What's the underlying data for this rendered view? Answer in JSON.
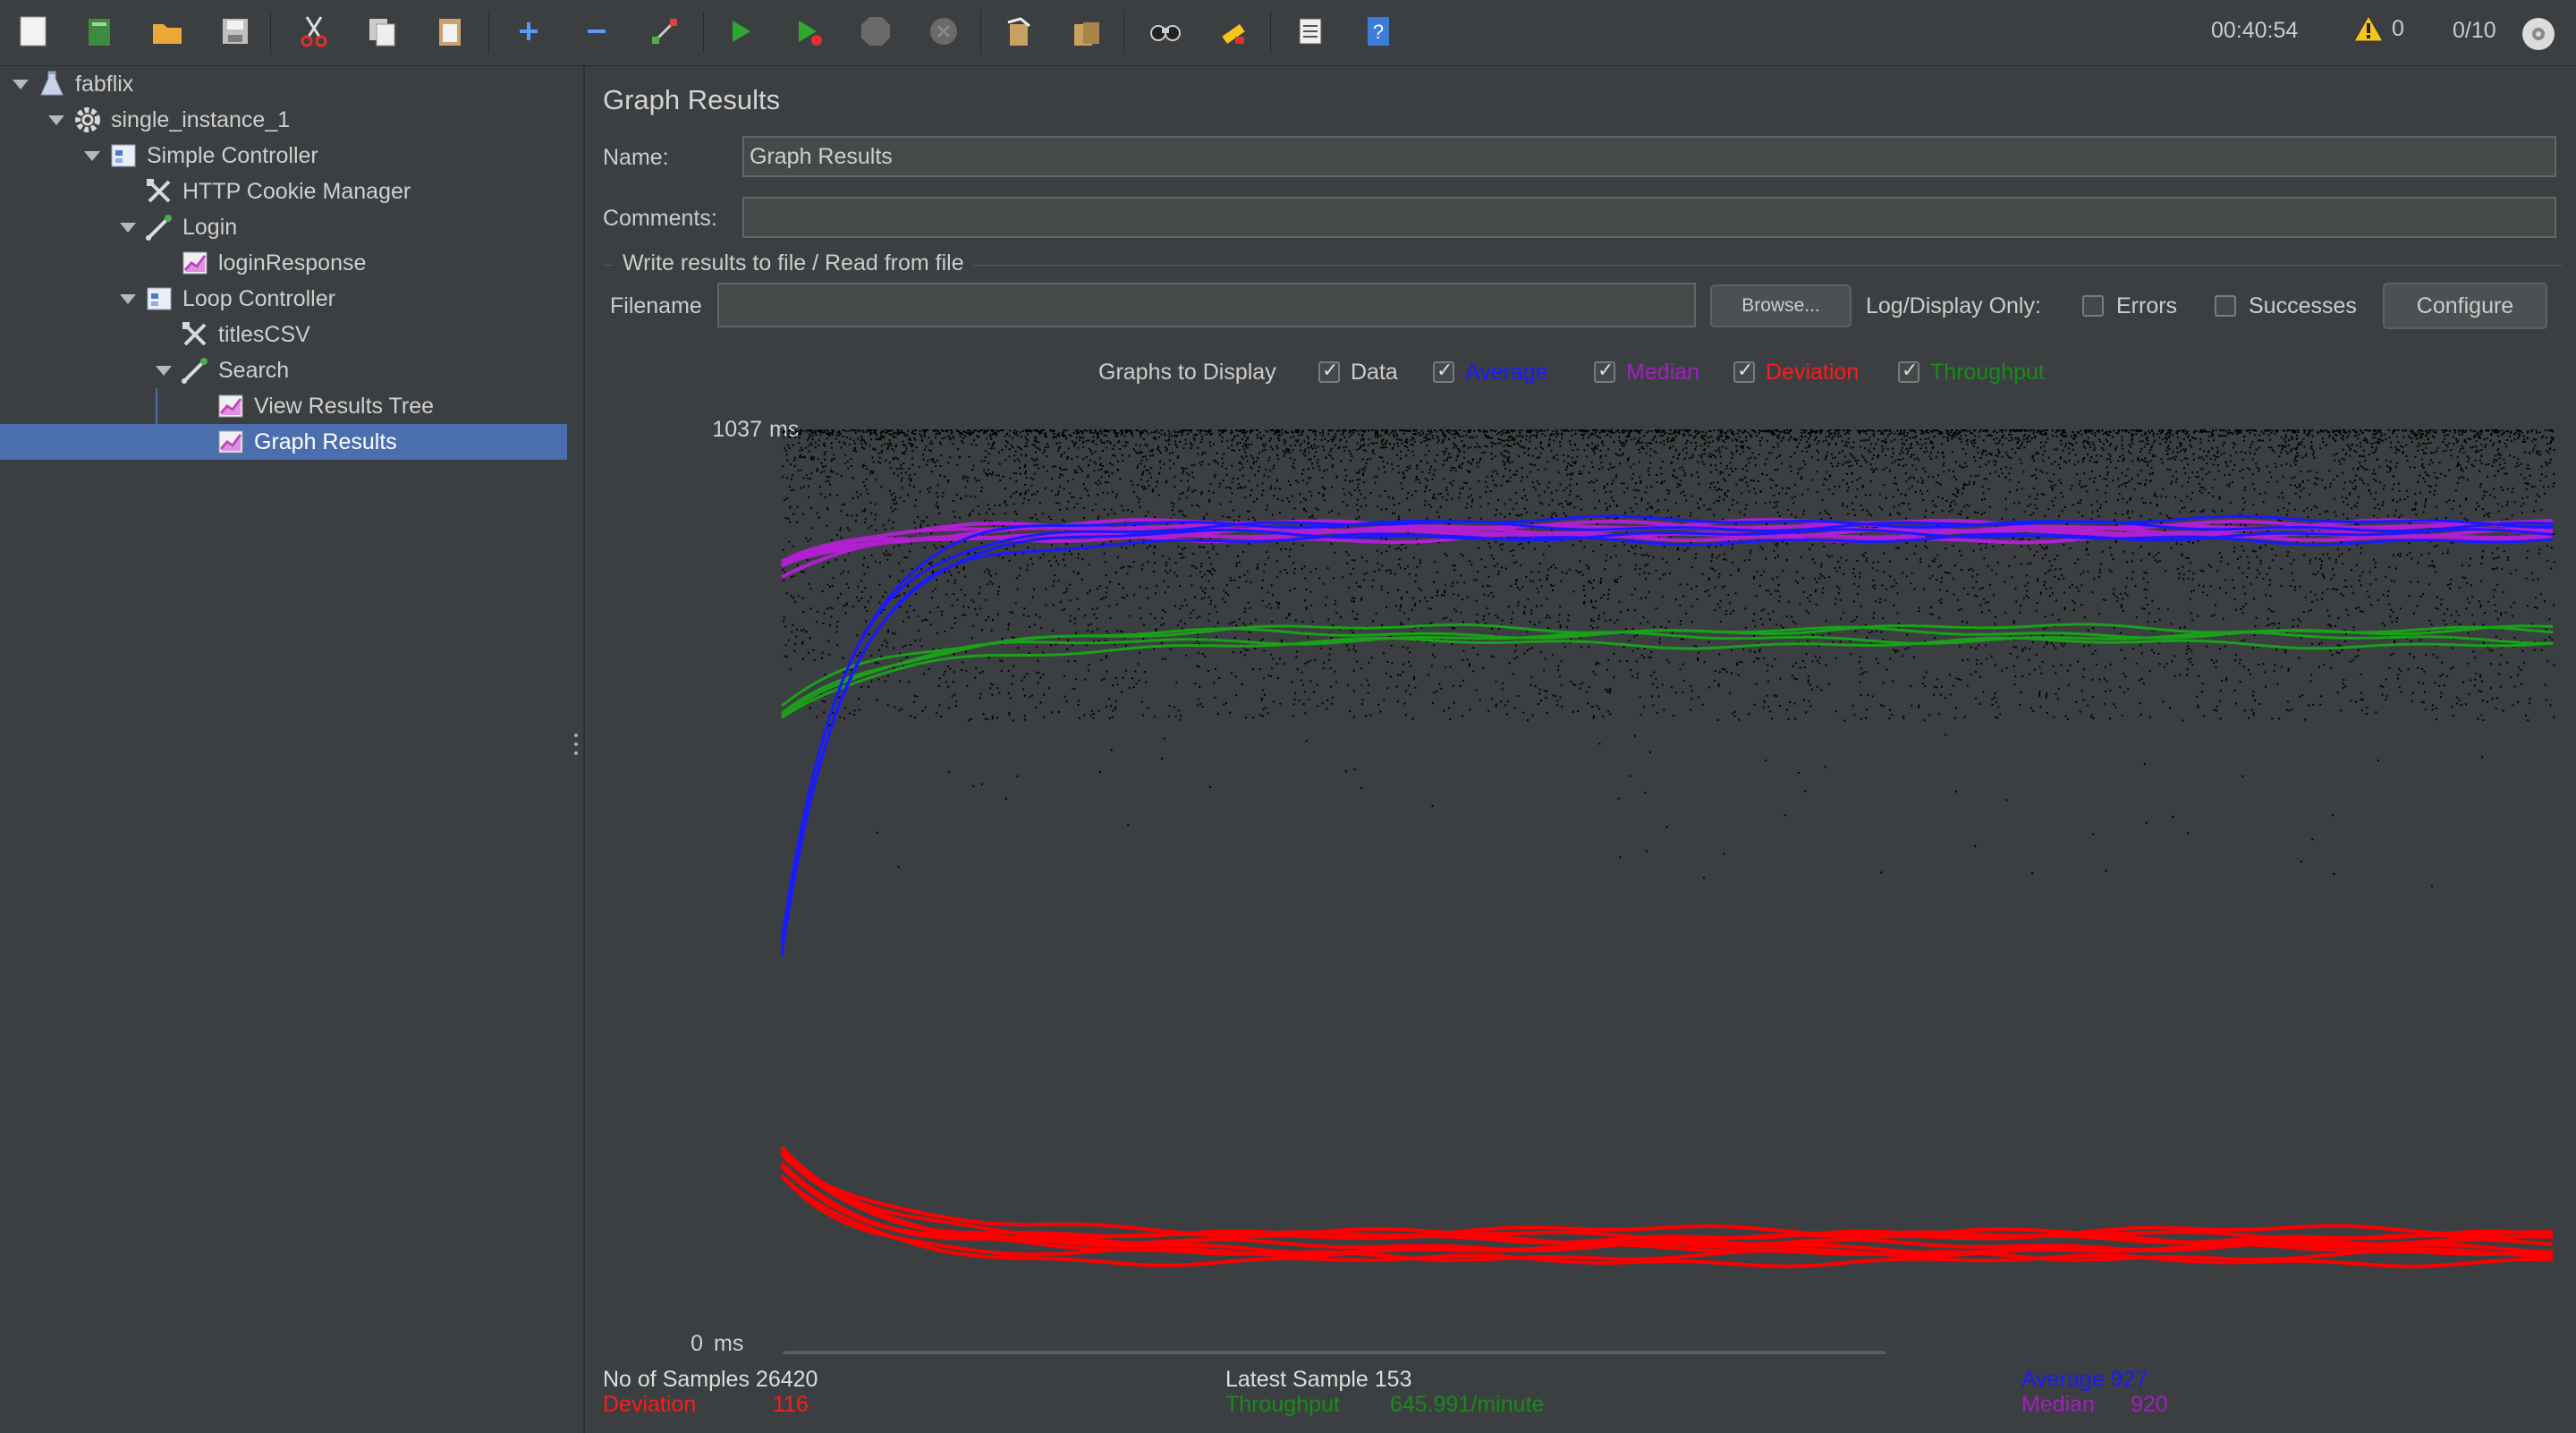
{
  "toolbar": {
    "buttons": [
      "new",
      "templates",
      "open",
      "save",
      "cut",
      "copy",
      "paste",
      "expand",
      "collapse",
      "toggle",
      "start",
      "start-no-pauses",
      "stop",
      "shutdown",
      "clear",
      "clear-all",
      "search",
      "reset-search",
      "function-helper",
      "help"
    ],
    "timer": "00:40:54",
    "warnings": "0",
    "threads": "0/10"
  },
  "tree": {
    "items": [
      {
        "label": "fabflix",
        "icon": "testplan-icon"
      },
      {
        "label": "single_instance_1",
        "icon": "thread-group-icon"
      },
      {
        "label": "Simple Controller",
        "icon": "controller-icon"
      },
      {
        "label": "HTTP Cookie Manager",
        "icon": "config-icon"
      },
      {
        "label": "Login",
        "icon": "sampler-icon"
      },
      {
        "label": "loginResponse",
        "icon": "listener-icon"
      },
      {
        "label": "Loop Controller",
        "icon": "controller-icon"
      },
      {
        "label": "titlesCSV",
        "icon": "config-icon"
      },
      {
        "label": "Search",
        "icon": "sampler-icon"
      },
      {
        "label": "View Results Tree",
        "icon": "listener-icon"
      },
      {
        "label": "Graph Results",
        "icon": "listener-icon"
      }
    ]
  },
  "panel": {
    "title": "Graph Results",
    "name_label": "Name:",
    "name_value": "Graph Results",
    "comments_label": "Comments:",
    "comments_value": "",
    "file_section": "Write results to file / Read from file",
    "filename_label": "Filename",
    "filename_value": "",
    "browse": "Browse...",
    "log_display_only": "Log/Display Only:",
    "errors": "Errors",
    "successes": "Successes",
    "configure": "Configure",
    "graphs_to_display": "Graphs to Display"
  },
  "series_toggles": [
    {
      "label": "Data",
      "color": "#cccccc",
      "checked": true
    },
    {
      "label": "Average",
      "color": "#1a1aff",
      "checked": true
    },
    {
      "label": "Median",
      "color": "#a020c0",
      "checked": true
    },
    {
      "label": "Deviation",
      "color": "#ff1a1a",
      "checked": true
    },
    {
      "label": "Throughput",
      "color": "#1a8a1a",
      "checked": true
    }
  ],
  "chart_data": {
    "type": "scatter",
    "ymax_label": "1037",
    "ymin_label": "0",
    "unit": "ms",
    "ylim": [
      0,
      1037
    ],
    "series": [
      {
        "name": "Data",
        "color": "#000000",
        "band": [
          550,
          1037
        ]
      },
      {
        "name": "Average",
        "final": 927,
        "start": 450,
        "color": "#1a1aff"
      },
      {
        "name": "Median",
        "final": 920,
        "start": 880,
        "color": "#b020d0"
      },
      {
        "name": "Deviation",
        "final": 116,
        "peak": 210,
        "color": "#ff0000"
      },
      {
        "name": "Throughput",
        "final": 810,
        "start": 720,
        "color": "#1aa01a"
      }
    ]
  },
  "stats": {
    "samples_label": "No of Samples",
    "samples_value": "26420",
    "latest_label": "Latest Sample",
    "latest_value": "153",
    "average_label": "Average",
    "average_value": "927",
    "deviation_label": "Deviation",
    "deviation_value": "116",
    "throughput_label": "Throughput",
    "throughput_value": "645.991/minute",
    "median_label": "Median",
    "median_value": "920"
  }
}
